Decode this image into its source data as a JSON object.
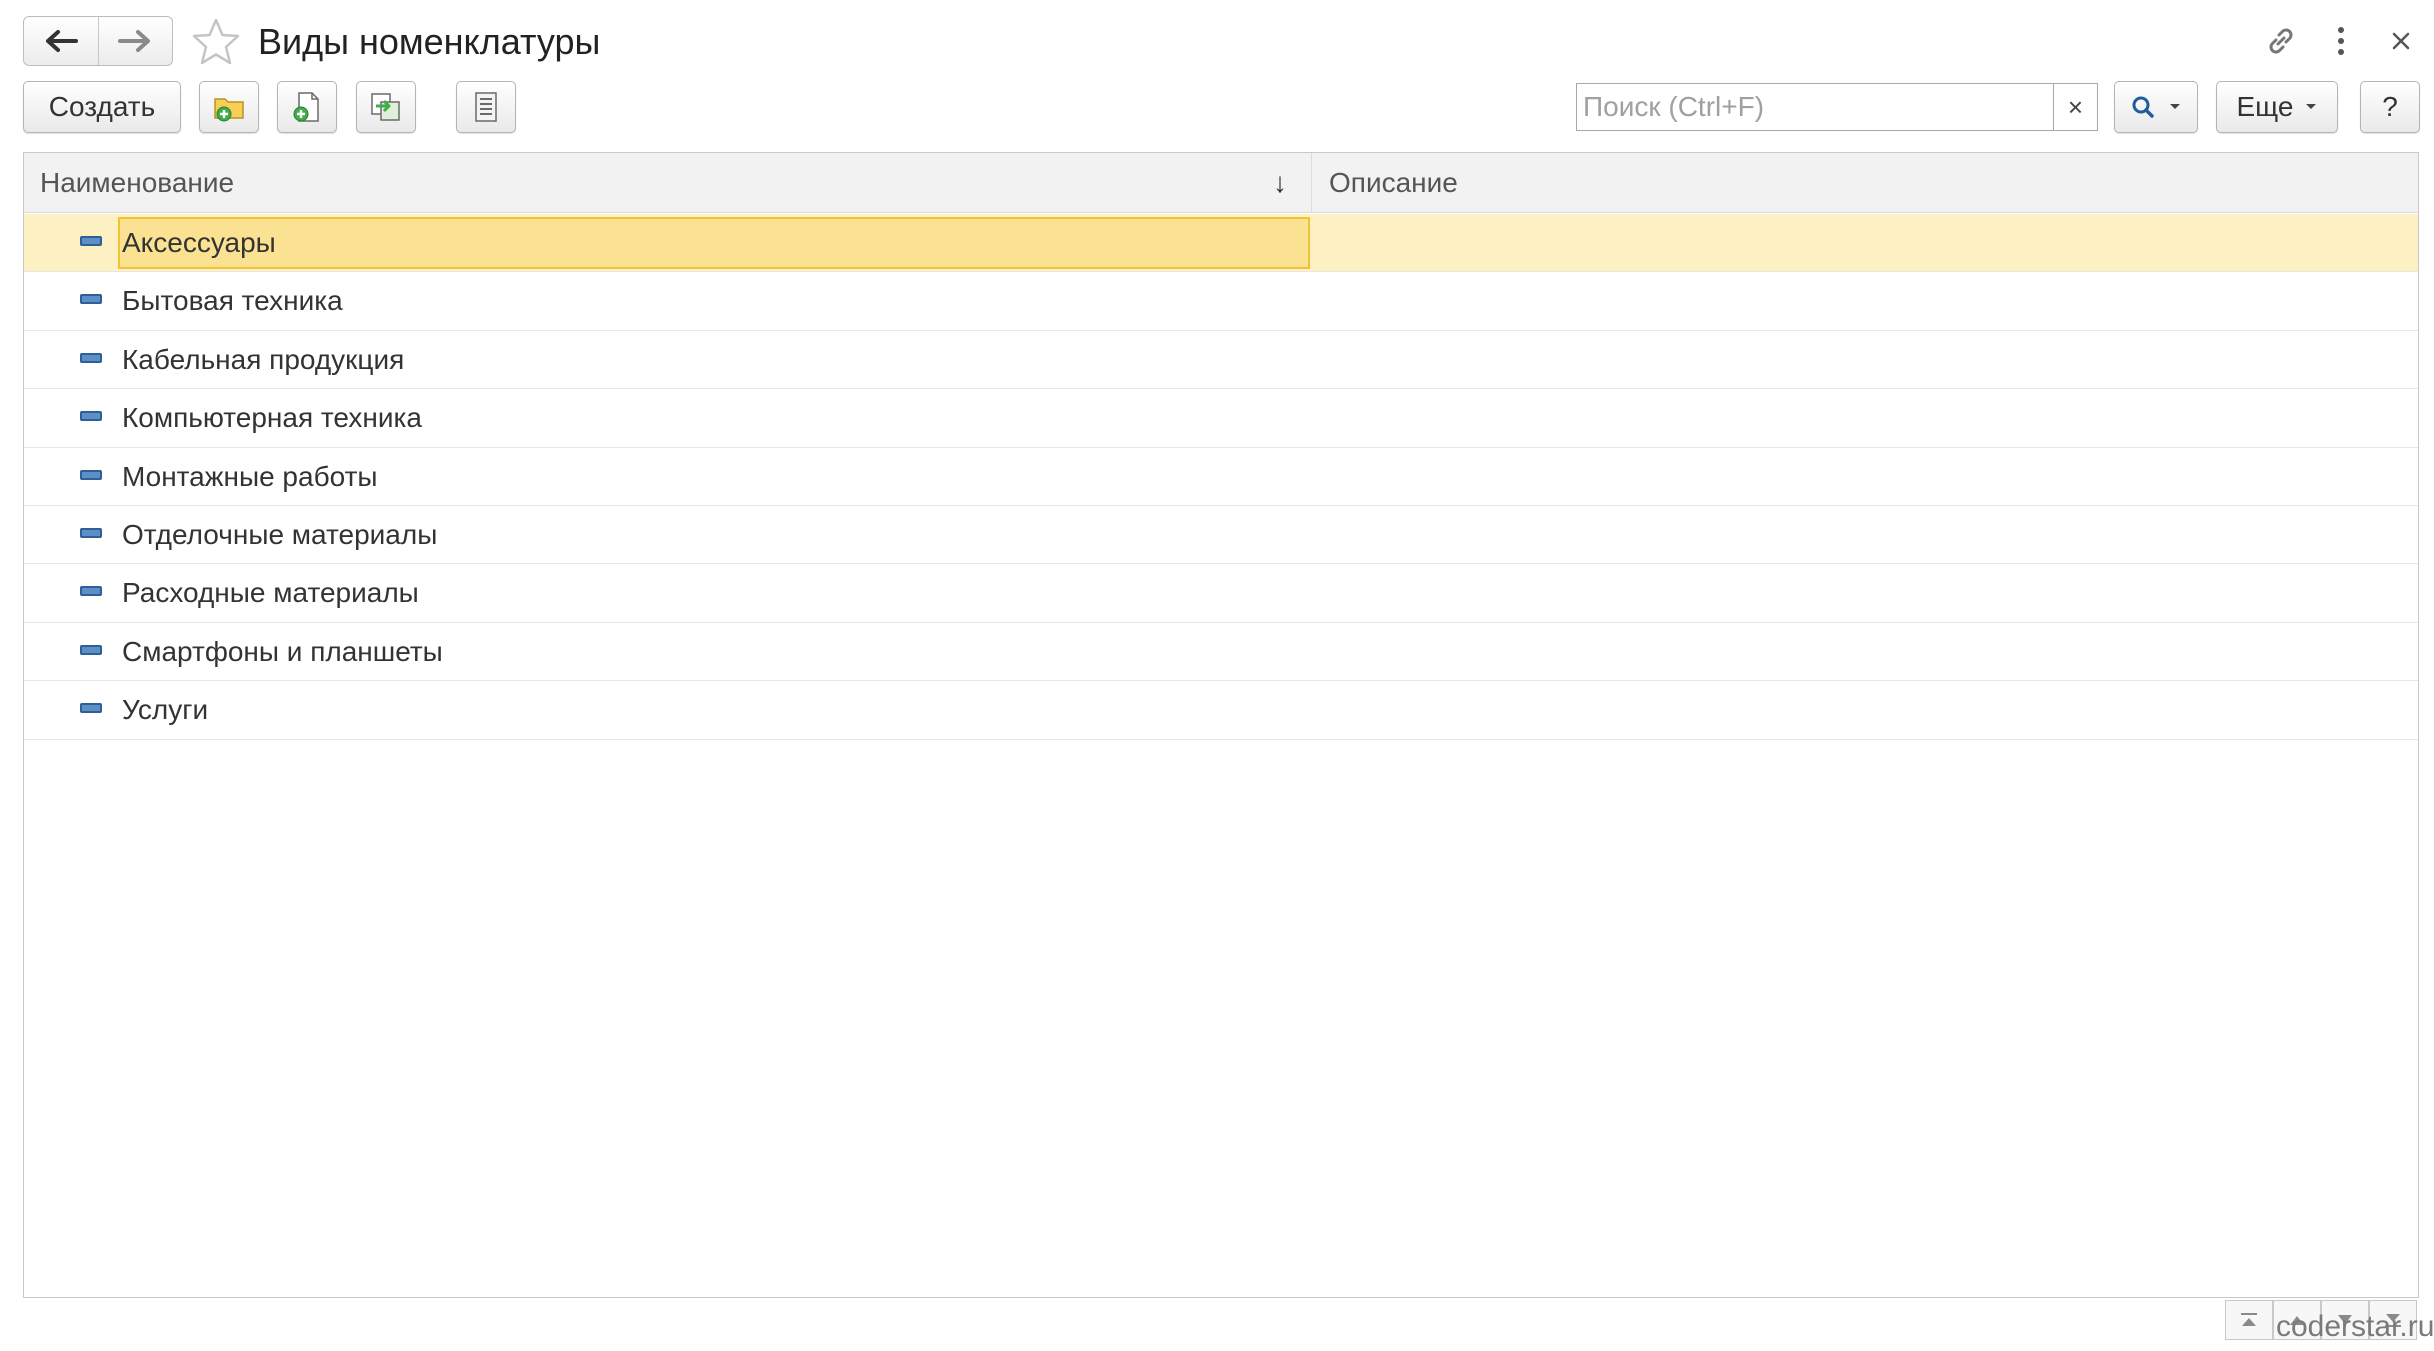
{
  "window": {
    "title": "Виды номенклатуры"
  },
  "toolbar": {
    "create_label": "Создать",
    "search_placeholder": "Поиск (Ctrl+F)",
    "search_clear": "×",
    "more_label": "Еще",
    "help_label": "?"
  },
  "table": {
    "columns": [
      {
        "label": "Наименование",
        "sort": "↓"
      },
      {
        "label": "Описание"
      }
    ],
    "rows": [
      {
        "name": "Аксессуары",
        "description": "",
        "selected": true
      },
      {
        "name": "Бытовая техника",
        "description": ""
      },
      {
        "name": "Кабельная продукция",
        "description": ""
      },
      {
        "name": "Компьютерная техника",
        "description": ""
      },
      {
        "name": "Монтажные работы",
        "description": ""
      },
      {
        "name": "Отделочные материалы",
        "description": ""
      },
      {
        "name": "Расходные материалы",
        "description": ""
      },
      {
        "name": "Смартфоны и планшеты",
        "description": ""
      },
      {
        "name": "Услуги",
        "description": ""
      }
    ]
  },
  "footer": {
    "watermark": "coderstar.ru"
  },
  "icons": {
    "back": "arrow-left-icon",
    "forward": "arrow-right-icon",
    "favorite": "star-icon",
    "link": "link-icon",
    "menu": "more-vertical-icon",
    "close": "close-icon",
    "create_group": "folder-add-icon",
    "copy": "document-add-icon",
    "move_to_group": "move-to-group-icon",
    "list_mode": "list-icon",
    "search": "search-icon",
    "row": "element-icon"
  },
  "colors": {
    "selected_row": "#fdf1c4",
    "selected_cell": "#fbe293",
    "selected_border": "#f1c232",
    "row_icon": "#5b8fc5"
  }
}
